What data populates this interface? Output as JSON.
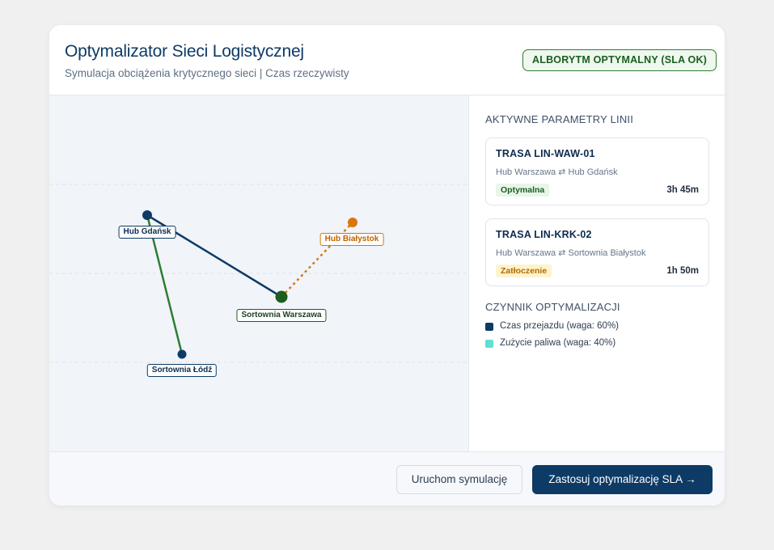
{
  "header": {
    "title": "Optymalizator Sieci Logistycznej",
    "subtitle": "Symulacja obciążenia krytycznego sieci | Czas rzeczywisty",
    "status_badge": "ALBORYTM OPTYMALNY (SLA OK)"
  },
  "map": {
    "nodes": {
      "gdansk": {
        "label": "Hub Gdańsk",
        "color": "#0d3b66"
      },
      "bialystok": {
        "label": "Hub Białystok",
        "color": "#d97706"
      },
      "warszawa": {
        "label": "Sortownia Warszawa",
        "color": "#1b5e20"
      },
      "lodz": {
        "label": "Sortownia Łódź",
        "color": "#0d3b66"
      }
    }
  },
  "side": {
    "active_title": "AKTYWNE PARAMETRY LINII",
    "routes": [
      {
        "title": "TRASA LIN-WAW-01",
        "path": "Hub Warszawa ⇄ Hub Gdańsk",
        "status": "Optymalna",
        "time": "3h 45m"
      },
      {
        "title": "TRASA LIN-KRK-02",
        "path": "Hub Warszawa ⇄ Sortownia Białystok",
        "status": "Zatłoczenie",
        "time": "1h 50m"
      }
    ],
    "factor_title": "CZYNNIK OPTYMALIZACJI",
    "factors": [
      {
        "label": "Czas przejazdu (waga: 60%)",
        "color": "#0d3b66"
      },
      {
        "label": "Zużycie paliwa (waga: 40%)",
        "color": "#5fe0d0"
      }
    ]
  },
  "footer": {
    "secondary_label": "Uruchom symulację",
    "primary_label": "Zastosuj optymalizację SLA →"
  },
  "colors": {
    "primary": "#0d3b66",
    "success": "#1b5e20",
    "warning": "#d97706"
  }
}
